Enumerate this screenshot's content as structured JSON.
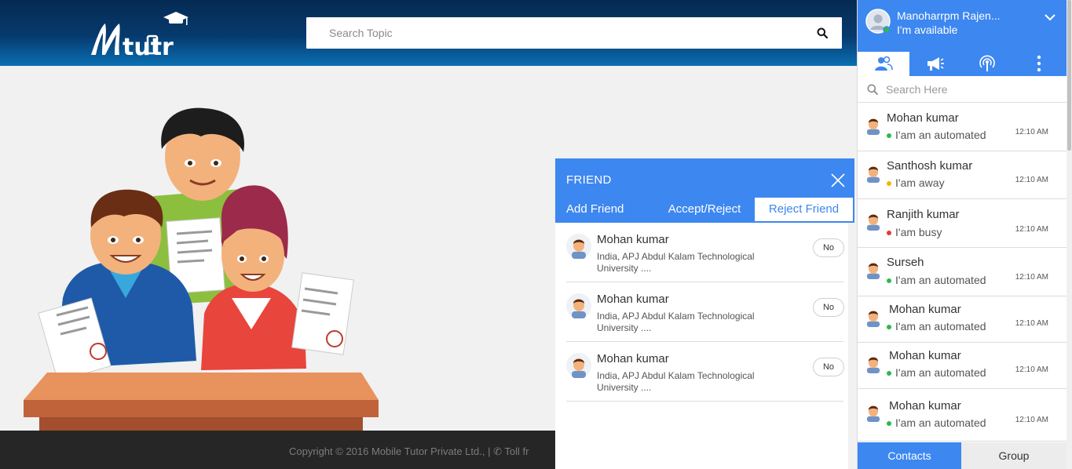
{
  "header": {
    "logo_text": "Mtutor",
    "search_placeholder": "Search Topic",
    "search_icon": "search-icon"
  },
  "footer": {
    "copyright": "Copyright © 2016 Mobile Tutor Private Ltd., | ✆ Toll fr"
  },
  "friend_dialog": {
    "title": "FRIEND",
    "tabs": [
      "Add Friend",
      "Accept/Reject",
      "Reject Friend"
    ],
    "active_tab": "Reject Friend",
    "rows": [
      {
        "name": "Mohan kumar",
        "sub": "India, APJ Abdul Kalam Technological University ....",
        "button": "No"
      },
      {
        "name": "Mohan kumar",
        "sub": "India, APJ Abdul Kalam Technological University ....",
        "button": "No"
      },
      {
        "name": "Mohan kumar",
        "sub": "India, APJ Abdul Kalam Technological University ....",
        "button": "No"
      }
    ]
  },
  "chat": {
    "user_name": "Manoharrpm Rajen...",
    "user_status": "I'm available",
    "tab_icons": [
      "contacts-icon",
      "megaphone-icon",
      "broadcast-icon",
      "more-vert-icon"
    ],
    "search_placeholder": "Search Here",
    "contacts": [
      {
        "name": "Mohan kumar",
        "status": "online",
        "message": "I'am an automated",
        "time": "12:10 AM"
      },
      {
        "name": "Santhosh kumar",
        "status": "away",
        "message": "I'am away",
        "time": "12:10 AM"
      },
      {
        "name": "Ranjith kumar",
        "status": "busy",
        "message": "I'am busy",
        "time": "12:10 AM"
      },
      {
        "name": "Surseh",
        "status": "online",
        "message": "I'am an automated",
        "time": "12:10 AM"
      },
      {
        "name": "Mohan kumar",
        "status": "online",
        "message": "I'am an automated",
        "time": "12:10 AM"
      },
      {
        "name": "Mohan kumar",
        "status": "online",
        "message": "I'am an automated",
        "time": "12:10 AM"
      },
      {
        "name": "Mohan kumar",
        "status": "online",
        "message": "I'am an automated",
        "time": "12:10 AM"
      }
    ],
    "bottom_tabs": [
      "Contacts",
      "Group"
    ],
    "active_bottom_tab": "Contacts"
  },
  "colors": {
    "accent": "#3d87f0",
    "online": "#2db84d",
    "away": "#f5b400",
    "busy": "#e53935"
  }
}
